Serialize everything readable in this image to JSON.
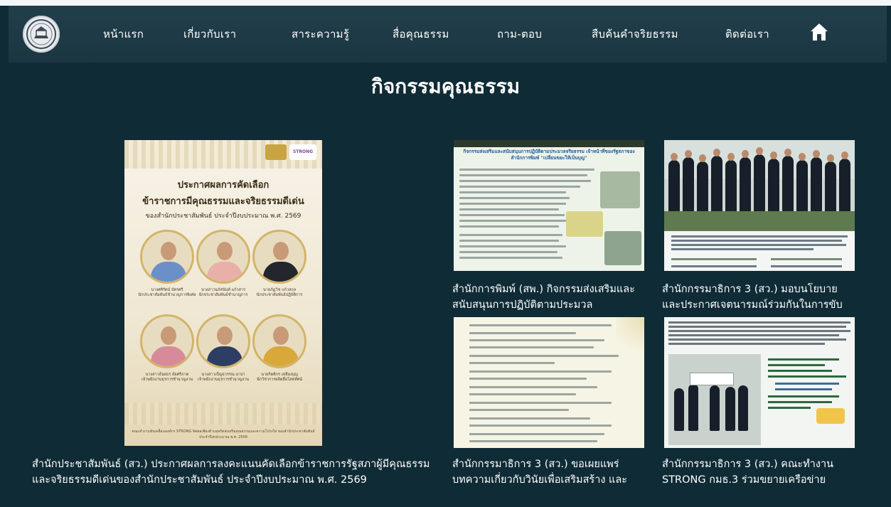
{
  "nav": {
    "items": [
      "หน้าแรก",
      "เกี่ยวกับเรา",
      "สาระความรู้",
      "สื่อคุณธรรม",
      "ถาม-ตอบ",
      "สืบค้นคำจริยธรรม",
      "ติดต่อเรา"
    ]
  },
  "page": {
    "title": "กิจกรรมคุณธรรม"
  },
  "cards": [
    {
      "caption": "สำนักประชาสัมพันธ์ (สว.) ประกาศผลการลงคะแนนคัดเลือกข้าราชการรัฐสภาผู้มีคุณธรรมและจริยธรรมดีเด่นของสำนักประชาสัมพันธ์ ประจำปีงบประมาณ พ.ศ. 2569",
      "poster": {
        "line1": "ประกาศผลการคัดเลือก",
        "line2": "ข้าราชการมีคุณธรรมและจริยธรรมดีเด่น",
        "line3": "ของสำนักประชาสัมพันธ์ ประจำปีงบประมาณ พ.ศ. 2569",
        "badge": "STRONG",
        "people": [
          {
            "name": "นางศศิรัตน์ บัตรศรี",
            "role": "นักประชาสัมพันธ์ชำนาญการพิเศษ"
          },
          {
            "name": "นางสาวนภัสนันท์ แก้วสาร",
            "role": "นักประชาสัมพันธ์ชำนาญการ"
          },
          {
            "name": "นายภัฏวิช แก้วสกุล",
            "role": "นักประชาสัมพันธ์ปฏิบัติการ"
          },
          {
            "name": "นางสาวธันยธร อัยศรีภาค",
            "role": "เจ้าพนักงานธุรการชำนาญงาน"
          },
          {
            "name": "นางสาวเบ็ญจวรรณ อาปา",
            "role": "เจ้าพนักงานธุรการชำนาญงาน"
          },
          {
            "name": "นายกิตติกร เหลืองบุญ",
            "role": "นักวิชาการผลิตสื่อโสตทัศน์"
          }
        ],
        "footer": "คณะทำงานขับเคลื่อนองค์กร STRONG จิตพอเพียงต้านทุจริตส่งเสริมคุณธรรมและความโปร่งใส ของสำนักประชาสัมพันธ์ ประจำปีงบประมาณ พ.ศ. 2569"
      }
    },
    {
      "caption": "สำนักการพิมพ์ (สพ.) กิจกรรมส่งเสริมและสนับสนุนการปฏิบัติตามประมวล",
      "doc_title": "กิจกรรมส่งเสริมและสนับสนุนการปฏิบัติตามประมวลจริยธรรม เจ้าหน้าที่ของรัฐสภาของสำนักการพิมพ์ \"เปลี่ยนขยะให้เป็นบุญ\""
    },
    {
      "caption": "สำนักกรรมาธิการ 3 (สว.) มอบนโยบายและประกาศเจตนารมณ์ร่วมกันในการขับ"
    },
    {
      "caption": "สำนักกรรมาธิการ 3 (สว.) ขอเผยแพร่บทความเกี่ยวกับวินัยเพื่อเสริมสร้าง และ"
    },
    {
      "caption": "สำนักกรรมาธิการ 3 (สว.) คณะทำงาน STRONG กมธ.3 ร่วมขยายเครือข่าย"
    }
  ]
}
